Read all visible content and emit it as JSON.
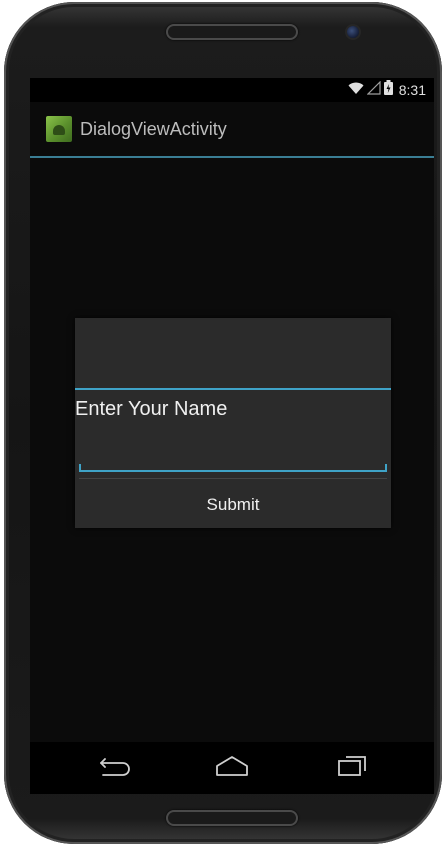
{
  "status_bar": {
    "time": "8:31",
    "icons": [
      "wifi-icon",
      "signal-icon",
      "battery-icon"
    ]
  },
  "action_bar": {
    "app_title": "DialogViewActivity",
    "icon": "app-launcher-icon"
  },
  "dialog": {
    "message": "Enter Your Name",
    "input_value": "",
    "submit_label": "Submit"
  },
  "nav_bar": {
    "buttons": [
      "back-icon",
      "home-icon",
      "recents-icon"
    ]
  },
  "colors": {
    "accent": "#3fa3c7",
    "dialog_bg": "#2b2b2b",
    "screen_bg": "#0b0b0b"
  }
}
